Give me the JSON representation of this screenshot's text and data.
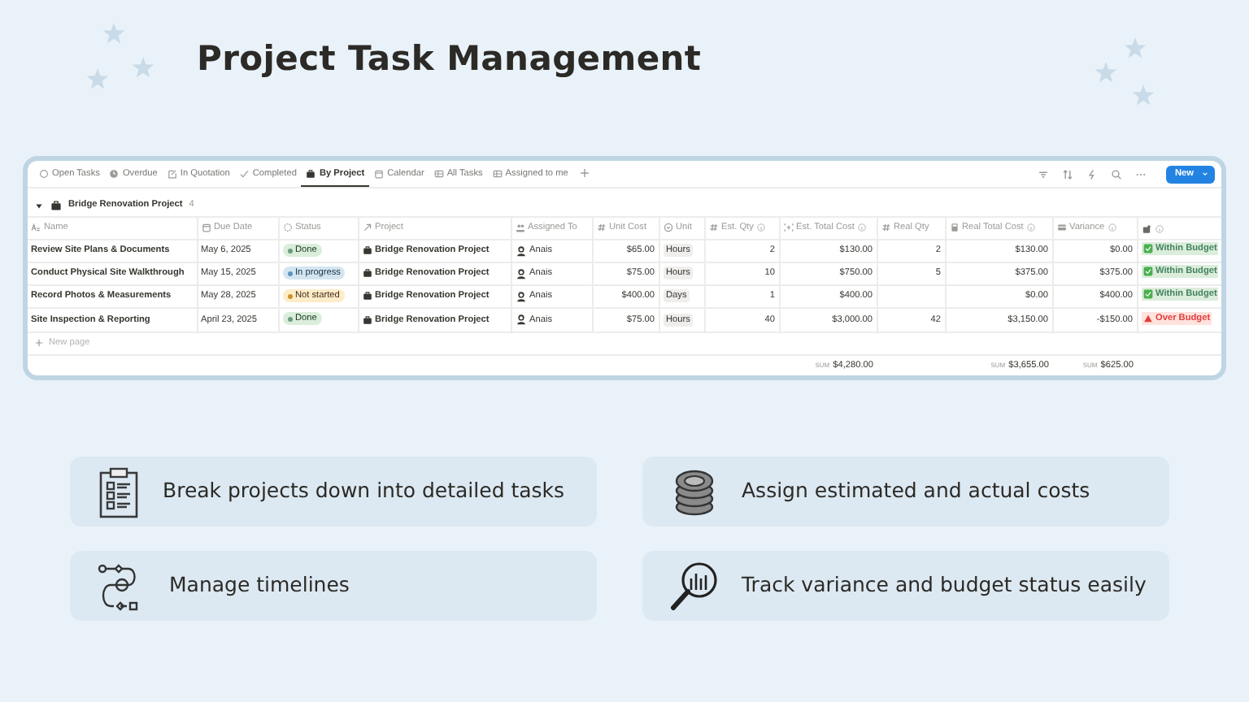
{
  "title": "Project Task Management",
  "tabs": [
    {
      "label": "Open Tasks",
      "selected": false
    },
    {
      "label": "Overdue",
      "selected": false
    },
    {
      "label": "In Quotation",
      "selected": false
    },
    {
      "label": "Completed",
      "selected": false
    },
    {
      "label": "By Project",
      "selected": true
    },
    {
      "label": "Calendar",
      "selected": false
    },
    {
      "label": "All Tasks",
      "selected": false
    },
    {
      "label": "Assigned to me",
      "selected": false
    }
  ],
  "new_button": "New",
  "group": {
    "name": "Bridge Renovation Project",
    "count": "4",
    "expanded": true
  },
  "columns": [
    {
      "label": "Name"
    },
    {
      "label": "Due Date"
    },
    {
      "label": "Status"
    },
    {
      "label": "Project"
    },
    {
      "label": "Assigned To"
    },
    {
      "label": "Unit Cost"
    },
    {
      "label": "Unit"
    },
    {
      "label": "Est. Qty"
    },
    {
      "label": "Est. Total Cost",
      "sum": {
        "label": "SUM",
        "value": "$4,280.00"
      }
    },
    {
      "label": "Real Qty"
    },
    {
      "label": "Real Total Cost",
      "sum": {
        "label": "SUM",
        "value": "$3,655.00"
      }
    },
    {
      "label": "Variance",
      "sum": {
        "label": "SUM",
        "value": "$625.00"
      }
    },
    {}
  ],
  "rows": [
    {
      "name": "Review Site Plans & Documents",
      "due": "May 6, 2025",
      "status": {
        "label": "Done",
        "kind": "done"
      },
      "project": "Bridge Renovation Project",
      "assignee": "Anais",
      "unit_cost": "$65.00",
      "unit": "Hours",
      "est_qty": "2",
      "est_total": "$130.00",
      "real_qty": "2",
      "real_total": "$130.00",
      "variance": "$0.00",
      "budget": {
        "label": "Within Budget",
        "kind": "within"
      }
    },
    {
      "name": "Conduct Physical Site Walkthrough",
      "due": "May 15, 2025",
      "status": {
        "label": "In progress",
        "kind": "in_progress"
      },
      "project": "Bridge Renovation Project",
      "assignee": "Anais",
      "unit_cost": "$75.00",
      "unit": "Hours",
      "est_qty": "10",
      "est_total": "$750.00",
      "real_qty": "5",
      "real_total": "$375.00",
      "variance": "$375.00",
      "budget": {
        "label": "Within Budget",
        "kind": "within"
      }
    },
    {
      "name": "Record Photos & Measurements",
      "due": "May 28, 2025",
      "status": {
        "label": "Not started",
        "kind": "not_started"
      },
      "project": "Bridge Renovation Project",
      "assignee": "Anais",
      "unit_cost": "$400.00",
      "unit": "Days",
      "est_qty": "1",
      "est_total": "$400.00",
      "real_total": "$0.00",
      "variance": "$400.00",
      "budget": {
        "label": "Within Budget",
        "kind": "within"
      }
    },
    {
      "name": "Site Inspection & Reporting",
      "due": "April 23, 2025",
      "status": {
        "label": "Done",
        "kind": "done"
      },
      "project": "Bridge Renovation Project",
      "assignee": "Anais",
      "unit_cost": "$75.00",
      "unit": "Hours",
      "est_qty": "40",
      "est_total": "$3,000.00",
      "real_qty": "42",
      "real_total": "$3,150.00",
      "variance": "-$150.00",
      "budget": {
        "label": "Over Budget",
        "kind": "over"
      }
    }
  ],
  "new_page": "New page",
  "features": [
    {
      "text": "Break projects down into detailed tasks"
    },
    {
      "text": "Assign estimated and actual costs"
    },
    {
      "text": "Manage timelines"
    },
    {
      "text": "Track variance and budget status easily"
    }
  ]
}
